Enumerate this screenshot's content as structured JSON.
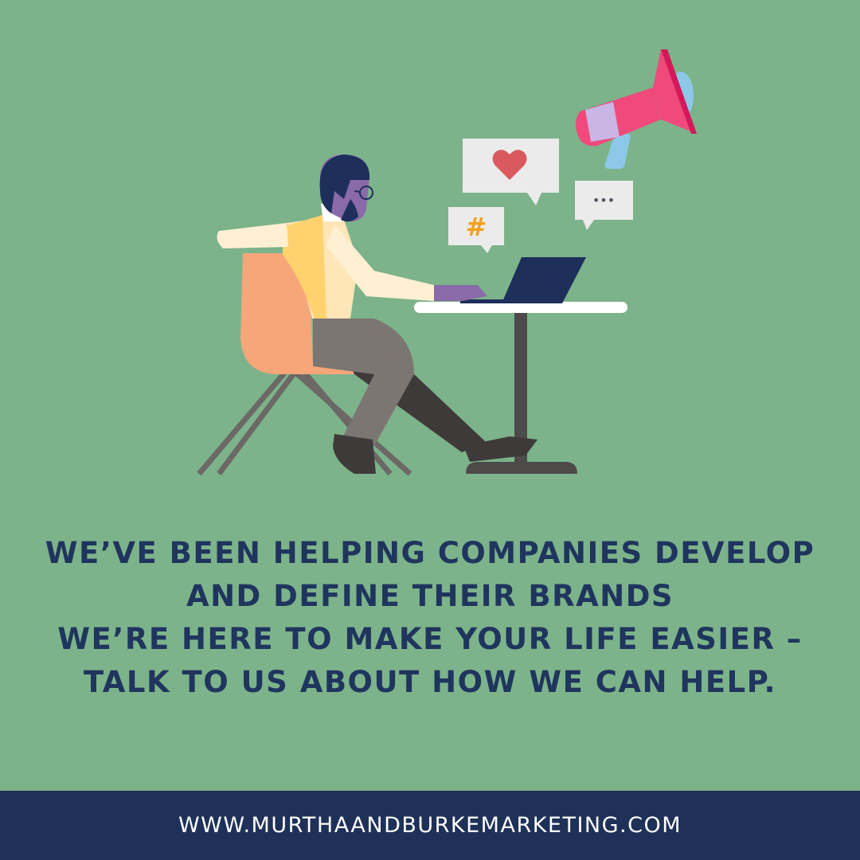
{
  "illustration": {
    "hashtag_symbol": "#",
    "ellipsis": "•••",
    "icons": [
      "heart-icon",
      "hashtag-icon",
      "ellipsis-icon",
      "megaphone-icon",
      "laptop-icon"
    ]
  },
  "headline": {
    "lines": [
      "We’ve been helping companies develop",
      "and define their brands",
      "We’re here to make your life easier –",
      "talk to us about how we can help."
    ]
  },
  "footer": {
    "url": "www.murthaandburkemarketing.com"
  },
  "colors": {
    "background": "#7db38a",
    "text": "#1f355e",
    "footer_bg": "#1f3158",
    "megaphone": "#ef4a7b",
    "heart": "#d9595f",
    "hashtag": "#f2a01c"
  }
}
